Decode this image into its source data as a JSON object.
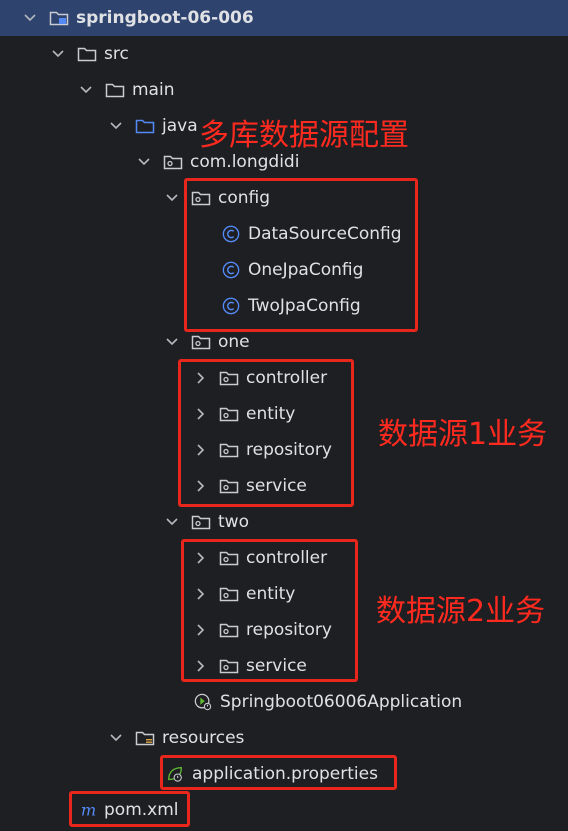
{
  "tree": {
    "project": "springboot-06-006",
    "src": "src",
    "main": "main",
    "java": "java",
    "package": "com.longdidi",
    "config": "config",
    "config_classes": [
      "DataSourceConfig",
      "OneJpaConfig",
      "TwoJpaConfig"
    ],
    "one": "one",
    "one_children": [
      "controller",
      "entity",
      "repository",
      "service"
    ],
    "two": "two",
    "two_children": [
      "controller",
      "entity",
      "repository",
      "service"
    ],
    "app_class": "Springboot06006Application",
    "resources": "resources",
    "properties_file": "application.properties",
    "pom": "pom.xml"
  },
  "annotations": {
    "multi_db_config": "多库数据源配置",
    "ds1_business": "数据源1业务",
    "ds2_business": "数据源2业务"
  },
  "colors": {
    "background": "#1e1f22",
    "selection": "#2e436e",
    "annotation_red": "#ff2a1f",
    "class_icon": "#548af7"
  }
}
